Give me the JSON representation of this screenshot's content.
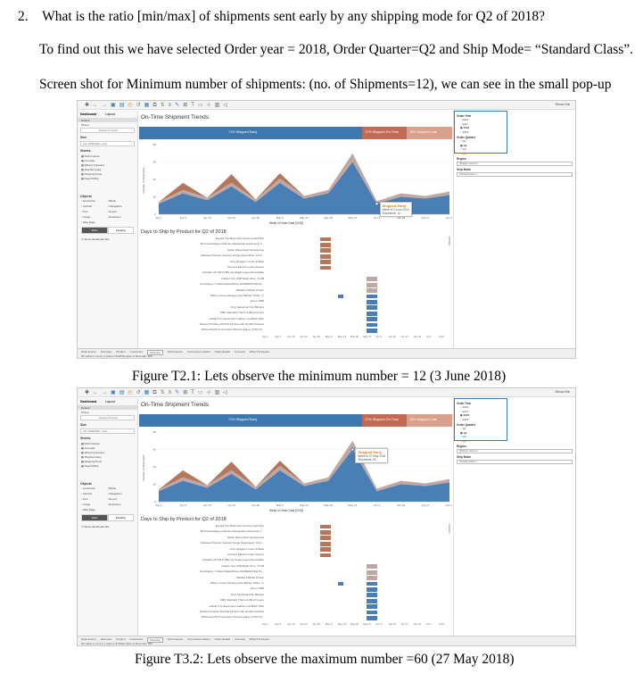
{
  "document": {
    "question": "2. What is the ratio [min/max] of shipments sent early by any shipping mode for Q2 of 2018?",
    "para1": "To find out this we have selected Order year = 2018, Order Quarter=Q2 and Ship Mode= “Standard Class”.",
    "para2": "Screen shot for Minimum number of shipments: (no. of Shipments=12), we can see in the small pop-up",
    "caption1": "Figure T2.1: Lets observe the minimum number = 12 (3 June 2018)",
    "caption2": "Figure T3.2: Lets observe the maximum number =60 (27 May 2018)"
  },
  "tableau": {
    "show_me": "Show Me",
    "dashboard_tab": "Dashboard",
    "layout_tab": "Layout",
    "device_default": "Default",
    "device_phone": "Phone",
    "device_preview": "Device Preview",
    "size_label": "Size",
    "size_value": "min 1000x620 - auto",
    "sheets_label": "Sheets",
    "sheets": [
      "Performance",
      "Forecast",
      "What If Forecast",
      "ShipSummary",
      "ShippingTrend",
      "DaysToShip"
    ],
    "objects_label": "Objects",
    "objects": [
      "Horizontal",
      "Blank",
      "Vertical",
      "Navigation",
      "Text",
      "Export",
      "Image",
      "Extension",
      "Web Page",
      ""
    ],
    "tiled": "Tiled",
    "floating": "Floating",
    "show_title": "Show dashboard title",
    "chart_title": "On-Time Shipment Trends",
    "gantt_title": "Days to Ship by Product for Q2 of 2018",
    "banner": {
      "early": "71% Shipped Early",
      "ontime": "17% Shipped On Time",
      "late": "12% Shipped Late"
    },
    "y_axis_label": "Number of Shipments",
    "x_axis_label": "Week of Order Date [2018]",
    "filters": {
      "order_year": "Order Year",
      "years": [
        "2016",
        "2017",
        "2018",
        "2019"
      ],
      "order_quarter": "Order Quarter",
      "quarters": [
        "Q1",
        "Q2",
        "Q3",
        "Q4"
      ],
      "region": "Region",
      "region_value": "(Multiple values)",
      "ship_mode": "Ship Mode",
      "ship_mode_value": "Standard Class"
    },
    "sheet_tabs": [
      "Data Source",
      "Overview",
      "Product",
      "Customers",
      "Shipping",
      "Performance",
      "Commission Model",
      "Order Details",
      "Forecast",
      "What If Forecast"
    ],
    "status_text": "36 marks   1 row by 1 column   SUM(Number of Records): 660",
    "gantt_products": [
      "Eureka The Boss Plus 12-Amp Hard Box",
      "Bush Advantage Collection Racetrack Conference T...",
      "Eldon Wave Desk Accessories",
      "Fellowes Premier Superior Surge Suppressor, 10-O...",
      "Poly Designer Cover & Back",
      "Premier Electric Letter Opener",
      "Verbatim 25 GB 6x Blu-ray Single Layer Recordable",
      "Imation City USB Flash drive - 8 GB",
      "Kensington 7 Outlet MasterPiece HOMEOFFICE Po...",
      "Okidata C331dn Printer",
      "Wilson Jones Hanging View Binder, White, 1\"",
      "Xerox 1995",
      "Vinyl Sectional Post Binders",
      "GBC Standard Therm-A-Bind Covers",
      "Global Troy Executive Leather Low-Back Tilter",
      "Stanley Pointline Pen/Pencil Sets with Double Pockets",
      "White Dual Perf Computer Printout Paper, 2700 Sh..."
    ],
    "weeks": [
      "Apr 1",
      "Apr 8",
      "Apr 15",
      "Apr 22",
      "Apr 29",
      "May 6",
      "May 13",
      "May 20",
      "May 27",
      "Jun 3",
      "Jun 10",
      "Jun 17",
      "Jun 24"
    ],
    "gantt_axis": [
      "Apr 1",
      "Apr 8",
      "Apr 15",
      "Apr 22",
      "Apr 29",
      "May 6",
      "May 13",
      "May 20",
      "May 27",
      "Jun 3",
      "Jun 10",
      "Jun 17",
      "Jun 24",
      "Jul 1",
      "Jul 8"
    ],
    "y_ticks": [
      "0",
      "20",
      "40",
      "60",
      "80"
    ]
  },
  "screenshots": [
    {
      "tooltip": {
        "title": "Shipped Early",
        "week": "Week of 3 June 2018",
        "shipments": "Shipments: 12"
      },
      "highlight_index": 9
    },
    {
      "tooltip": {
        "title": "Shipped Early",
        "week": "Week of 27 May 2018",
        "shipments": "Shipments: 60"
      },
      "highlight_index": 8
    }
  ],
  "chart_data": [
    {
      "type": "area",
      "title": "On-Time Shipment Trends",
      "xlabel": "Week of Order Date [2018]",
      "ylabel": "Number of Shipments",
      "ylim": [
        0,
        80
      ],
      "categories": [
        "Apr 1",
        "Apr 8",
        "Apr 15",
        "Apr 22",
        "Apr 29",
        "May 6",
        "May 13",
        "May 20",
        "May 27",
        "Jun 3",
        "Jun 10",
        "Jun 17",
        "Jun 24"
      ],
      "series": [
        {
          "name": "Shipped Early",
          "values": [
            12,
            24,
            16,
            32,
            14,
            36,
            18,
            24,
            60,
            12,
            20,
            18,
            22
          ]
        },
        {
          "name": "Shipped On Time",
          "values": [
            2,
            4,
            3,
            4,
            3,
            5,
            3,
            4,
            10,
            3,
            4,
            3,
            4
          ]
        },
        {
          "name": "Shipped Late",
          "values": [
            0,
            8,
            0,
            10,
            0,
            6,
            0,
            0,
            0,
            0,
            0,
            0,
            0
          ]
        }
      ],
      "colors": {
        "early": "#4a7fb5",
        "ontime": "#bfa8a3",
        "late": "#b4775b"
      }
    }
  ]
}
